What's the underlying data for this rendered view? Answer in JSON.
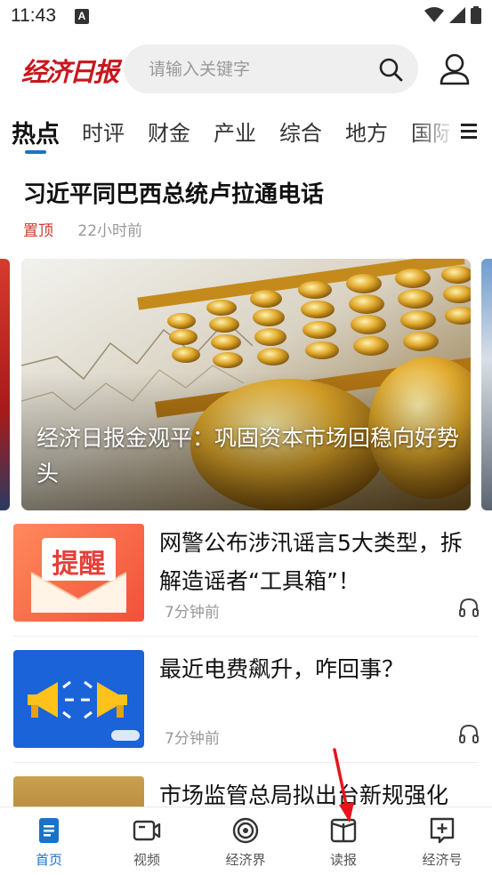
{
  "status_bar": {
    "time": "11:43",
    "notif_letter": "A"
  },
  "header": {
    "logo_text": "经济日报",
    "search_placeholder": "请输入关键字"
  },
  "tabs": [
    {
      "label": "热点",
      "active": true
    },
    {
      "label": "时评"
    },
    {
      "label": "财金"
    },
    {
      "label": "产业"
    },
    {
      "label": "综合"
    },
    {
      "label": "地方"
    },
    {
      "label": "国际"
    }
  ],
  "headline": {
    "title": "习近平同巴西总统卢拉通电话",
    "badge": "置顶",
    "time": "22小时前"
  },
  "carousel": {
    "caption": "经济日报金观平：巩固资本市场回稳向好势头"
  },
  "news": [
    {
      "title": "网警公布涉汛谣言5大类型，拆解造谣者“工具箱”！",
      "time": "7分钟前",
      "thumb_text": "提醒"
    },
    {
      "title": "最近电费飙升，咋回事？",
      "time": "7分钟前"
    },
    {
      "title": "市场监管总局拟出台新规强化"
    }
  ],
  "bottom_nav": [
    {
      "label": "首页",
      "icon": "document-icon",
      "active": true
    },
    {
      "label": "视频",
      "icon": "video-icon"
    },
    {
      "label": "经济界",
      "icon": "target-icon"
    },
    {
      "label": "读报",
      "icon": "book-icon"
    },
    {
      "label": "经济号",
      "icon": "add-box-icon"
    }
  ],
  "colors": {
    "accent": "#1a73c8",
    "brand_red": "#c8161d",
    "pin_red": "#d03a2c"
  }
}
